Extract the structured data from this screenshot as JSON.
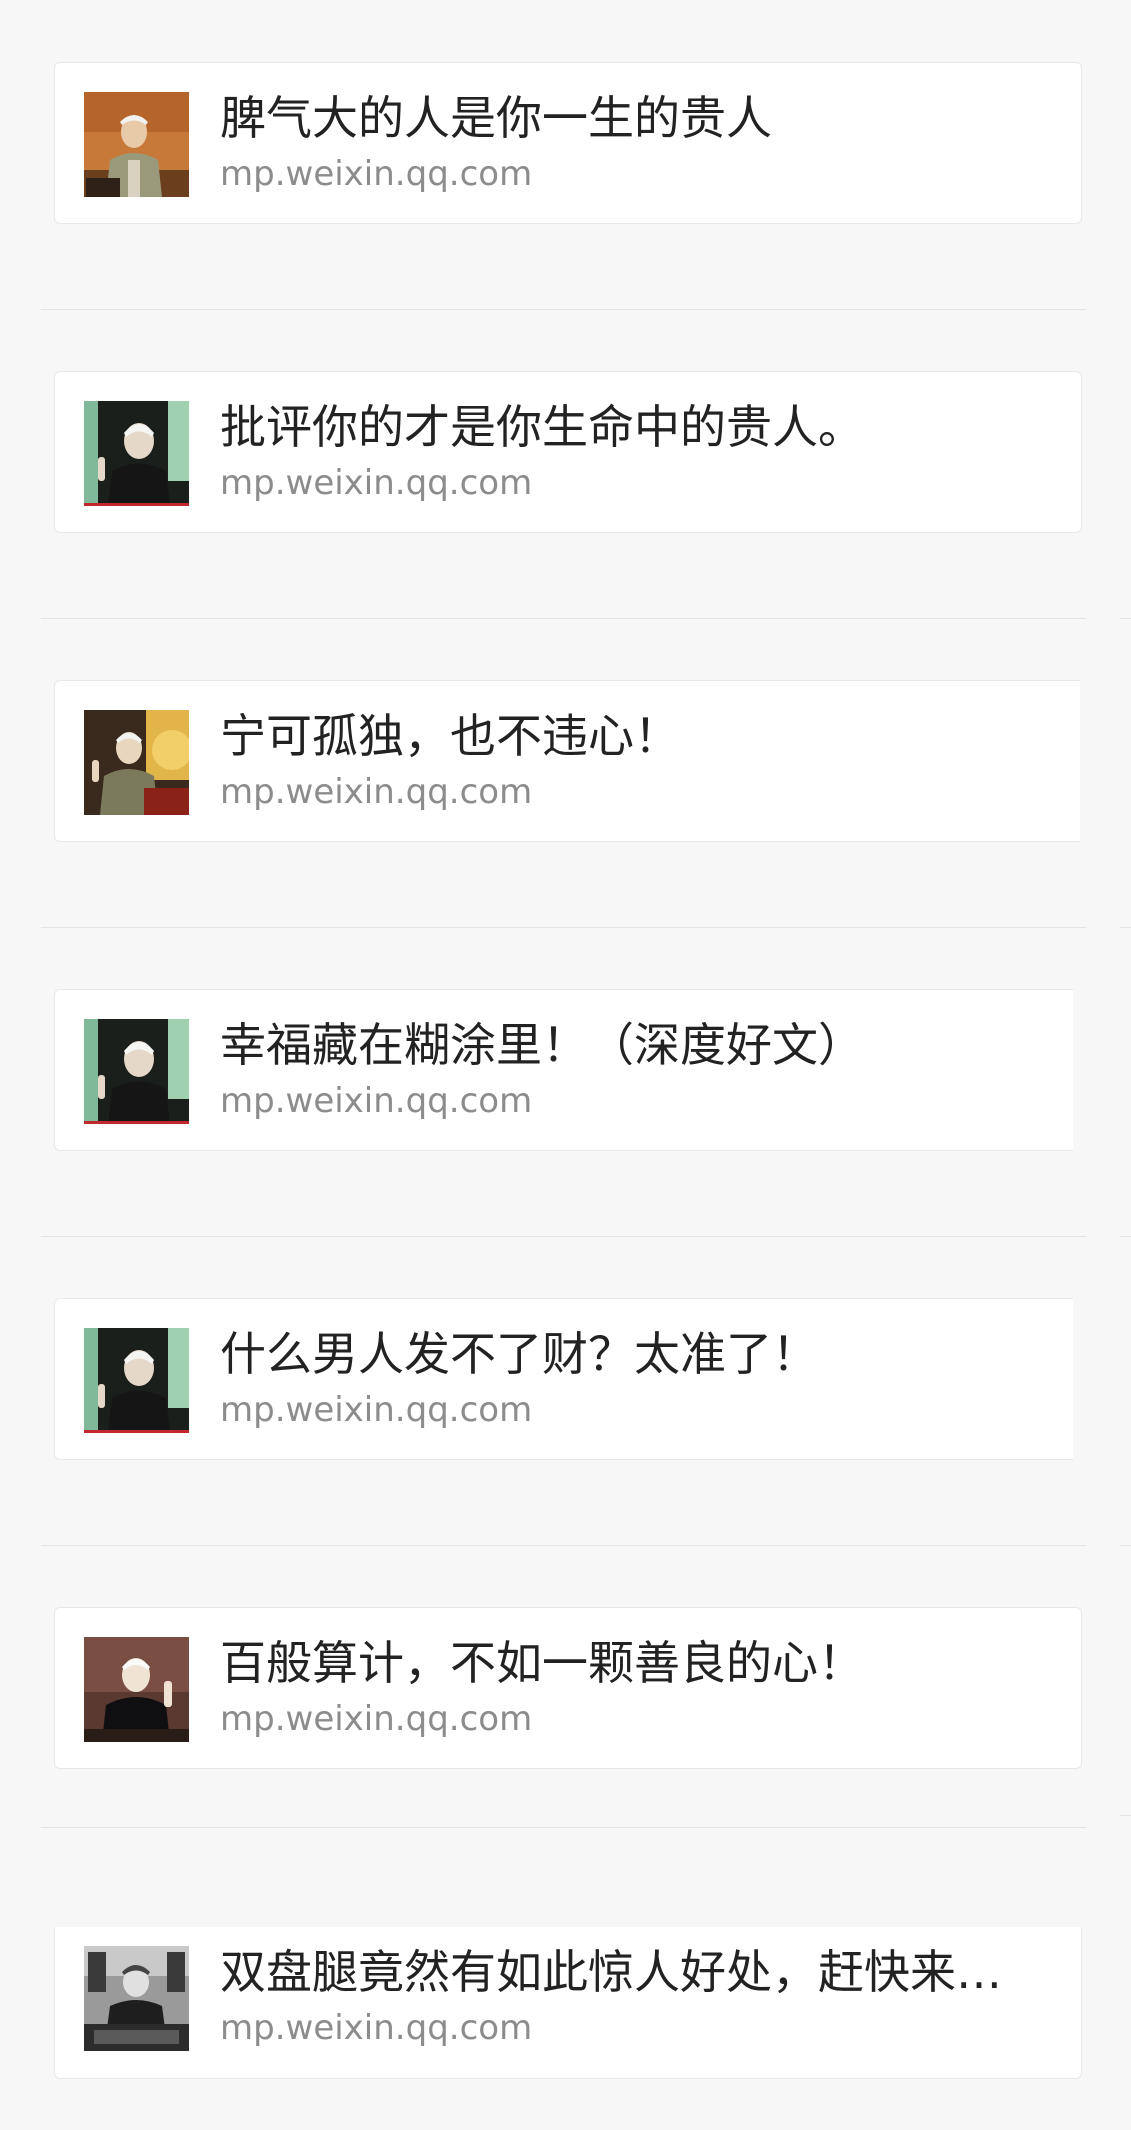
{
  "articles": [
    {
      "title": "脾气大的人是你一生的贵人",
      "source": "mp.weixin.qq.com",
      "thumb_icon": "elderly-man-orange-photo"
    },
    {
      "title": "批评你的才是你生命中的贵人。",
      "source": "mp.weixin.qq.com",
      "thumb_icon": "elderly-man-green-photo"
    },
    {
      "title": "宁可孤独，也不违心！",
      "source": "mp.weixin.qq.com",
      "thumb_icon": "elderly-man-stage-photo"
    },
    {
      "title": "幸福藏在糊涂里！（深度好文）",
      "source": "mp.weixin.qq.com",
      "thumb_icon": "elderly-man-green-photo"
    },
    {
      "title": "什么男人发不了财？太准了！",
      "source": "mp.weixin.qq.com",
      "thumb_icon": "elderly-man-green-photo"
    },
    {
      "title": "百般算计，不如一颗善良的心！",
      "source": "mp.weixin.qq.com",
      "thumb_icon": "elderly-man-dark-photo"
    },
    {
      "title": "双盘腿竟然有如此惊人好处，赶快来…",
      "source": "mp.weixin.qq.com",
      "thumb_icon": "elderly-man-bw-photo"
    }
  ],
  "colors": {
    "background": "#f7f7f7",
    "card": "#ffffff",
    "title_text": "#222222",
    "source_text": "#8c8c8c",
    "divider": "#e5e5e5"
  }
}
